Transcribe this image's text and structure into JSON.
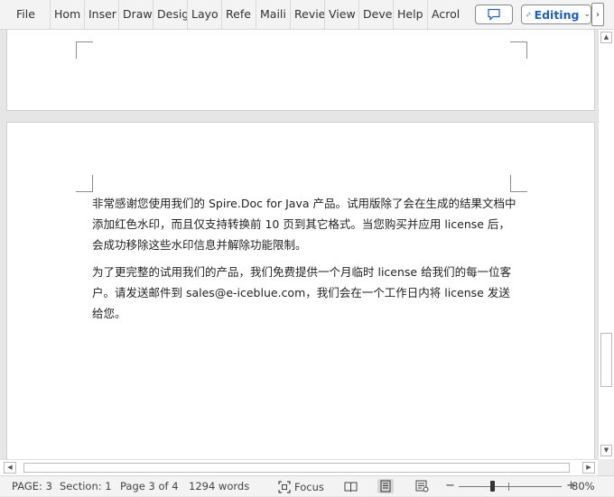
{
  "ribbon": {
    "tabs": [
      "File",
      "Hom",
      "Inser",
      "Draw",
      "Desig",
      "Layo",
      "Refe",
      "Maili",
      "Revie",
      "View",
      "Deve",
      "Help",
      "Acrol"
    ],
    "editing_label": "Editing"
  },
  "document": {
    "paragraphs": [
      "非常感谢您使用我们的 Spire.Doc for Java 产品。试用版除了会在生成的结果文档中添加红色水印，而且仅支持转换前 10 页到其它格式。当您购买并应用 license 后，会成功移除这些水印信息并解除功能限制。",
      "为了更完整的试用我们的产品，我们免费提供一个月临时 license 给我们的每一位客户。请发送邮件到 sales@e-iceblue.com，我们会在一个工作日内将 license 发送给您。"
    ]
  },
  "status": {
    "page": "PAGE: 3",
    "section": "Section: 1",
    "page_of": "Page 3 of 4",
    "words": "1294 words",
    "focus": "Focus",
    "zoom_minus": "−",
    "zoom_plus": "+",
    "zoom": "80%"
  }
}
